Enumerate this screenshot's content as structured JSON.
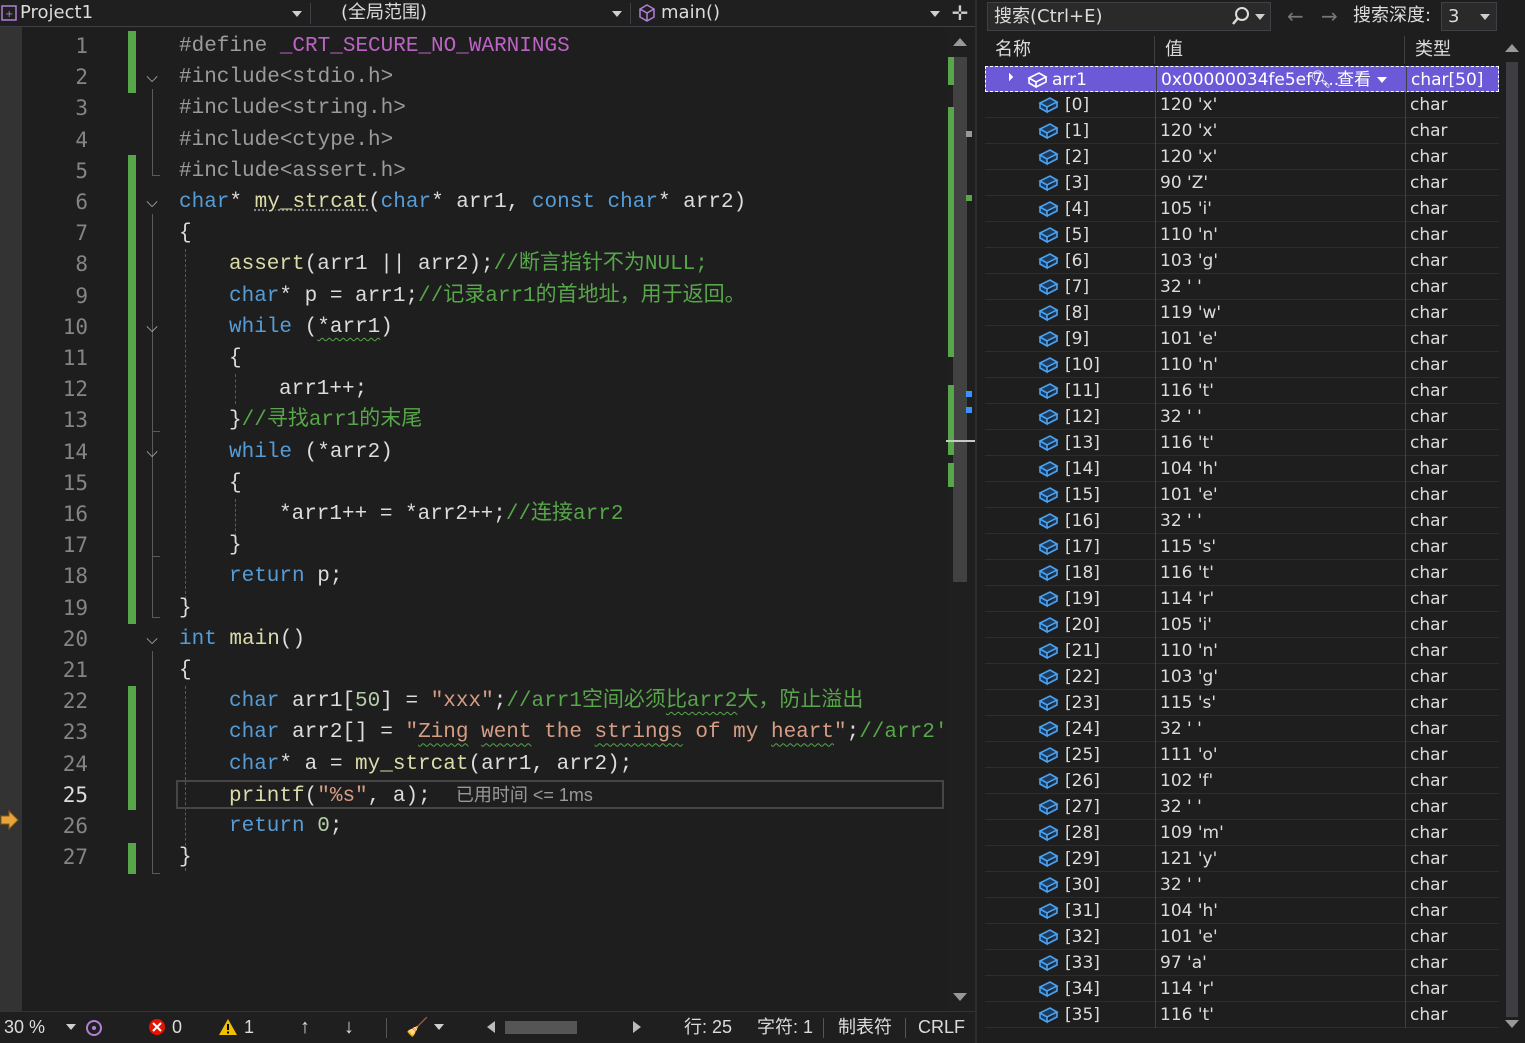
{
  "nav": {
    "project": "Project1",
    "scope": "(全局范围)",
    "function": "main()"
  },
  "editor": {
    "current_line": 25,
    "perf_tip": "已用时间 <= 1ms",
    "lines": [
      {
        "n": "1"
      },
      {
        "n": "2"
      },
      {
        "n": "3"
      },
      {
        "n": "4"
      },
      {
        "n": "5"
      },
      {
        "n": "6"
      },
      {
        "n": "7"
      },
      {
        "n": "8"
      },
      {
        "n": "9"
      },
      {
        "n": "10"
      },
      {
        "n": "11"
      },
      {
        "n": "12"
      },
      {
        "n": "13"
      },
      {
        "n": "14"
      },
      {
        "n": "15"
      },
      {
        "n": "16"
      },
      {
        "n": "17"
      },
      {
        "n": "18"
      },
      {
        "n": "19"
      },
      {
        "n": "20"
      },
      {
        "n": "21"
      },
      {
        "n": "22"
      },
      {
        "n": "23"
      },
      {
        "n": "24"
      },
      {
        "n": "25"
      },
      {
        "n": "26"
      },
      {
        "n": "27"
      }
    ],
    "code": {
      "l1": {
        "a": "#define ",
        "b": "_CRT_SECURE_NO_WARNINGS"
      },
      "l2": "#include<stdio.h>",
      "l3": "#include<string.h>",
      "l4": "#include<ctype.h>",
      "l5": "#include<assert.h>",
      "l6": {
        "t1": "char",
        "t2": "* ",
        "fn": "my_strcat",
        "t3": "(",
        "t4": "char",
        "t5": "* arr1, ",
        "t6": "const",
        "t7": " ",
        "t8": "char",
        "t9": "* arr2)"
      },
      "l7": "{",
      "l8": {
        "fn": "assert",
        "t1": "(arr1 || arr2);",
        "cm": "//断言指针不为NULL;"
      },
      "l9": {
        "kw": "char",
        "t1": "* p = arr1;",
        "cm": "//记录arr1的首地址，用于返回。"
      },
      "l10": {
        "kw": "while",
        "t1": " (",
        "w": "*arr1",
        "t2": ")"
      },
      "l11": "{",
      "l12": "arr1++;",
      "l13": {
        "t1": "}",
        "cm": "//寻找arr1的末尾"
      },
      "l14": {
        "kw": "while",
        "t1": " (*arr2)"
      },
      "l15": "{",
      "l16": {
        "t1": "*arr1++ = *arr2++;",
        "cm": "//连接arr2"
      },
      "l17": "}",
      "l18": {
        "kw": "return",
        "t1": " p;"
      },
      "l19": "}",
      "l20": {
        "kw": "int",
        "t1": " ",
        "fn": "main",
        "t2": "()"
      },
      "l21": "{",
      "l22": {
        "kw": "char",
        "t1": " arr1[",
        "num": "50",
        "t2": "] = ",
        "st": "\"xxx\"",
        "t3": ";",
        "cm1": "//arr1空间必须",
        "cmw": "比arr2",
        "cm2": "大，防止溢出"
      },
      "l23": {
        "kw": "char",
        "t1": " arr2[] = ",
        "s1": "\"",
        "w1": "Zing",
        "s2": " ",
        "w2": "went",
        "s3": " the ",
        "w3": "strings",
        "s4": " of my ",
        "w4": "heart",
        "s5": "\"",
        "t2": ";",
        "cm": "//arr2'"
      },
      "l24": {
        "kw": "char",
        "t1": "* a = ",
        "fn": "my_strcat",
        "t2": "(arr1, arr2);"
      },
      "l25": {
        "fn": "printf",
        "t1": "(",
        "st": "\"%s\"",
        "t2": ", a);"
      },
      "l26": {
        "kw": "return",
        "t1": " ",
        "num": "0",
        "t2": ";"
      },
      "l27": "}"
    }
  },
  "statusbar": {
    "zoom": "30 %",
    "errors": "0",
    "warnings": "1",
    "line": "行: 25",
    "char": "字符: 1",
    "tabs": "制表符",
    "eol": "CRLF"
  },
  "watch": {
    "search_placeholder": "搜索(Ctrl+E)",
    "depth_label": "搜索深度:",
    "depth_value": "3",
    "columns": {
      "name": "名称",
      "value": "值",
      "type": "类型"
    },
    "root": {
      "name": "arr1",
      "value": "0x00000034fe5ef7...",
      "view": "查看",
      "type": "char[50]"
    },
    "items": [
      {
        "name": "[0]",
        "value": "120 'x'",
        "type": "char"
      },
      {
        "name": "[1]",
        "value": "120 'x'",
        "type": "char"
      },
      {
        "name": "[2]",
        "value": "120 'x'",
        "type": "char"
      },
      {
        "name": "[3]",
        "value": "90 'Z'",
        "type": "char"
      },
      {
        "name": "[4]",
        "value": "105 'i'",
        "type": "char"
      },
      {
        "name": "[5]",
        "value": "110 'n'",
        "type": "char"
      },
      {
        "name": "[6]",
        "value": "103 'g'",
        "type": "char"
      },
      {
        "name": "[7]",
        "value": "32 ' '",
        "type": "char"
      },
      {
        "name": "[8]",
        "value": "119 'w'",
        "type": "char"
      },
      {
        "name": "[9]",
        "value": "101 'e'",
        "type": "char"
      },
      {
        "name": "[10]",
        "value": "110 'n'",
        "type": "char"
      },
      {
        "name": "[11]",
        "value": "116 't'",
        "type": "char"
      },
      {
        "name": "[12]",
        "value": "32 ' '",
        "type": "char"
      },
      {
        "name": "[13]",
        "value": "116 't'",
        "type": "char"
      },
      {
        "name": "[14]",
        "value": "104 'h'",
        "type": "char"
      },
      {
        "name": "[15]",
        "value": "101 'e'",
        "type": "char"
      },
      {
        "name": "[16]",
        "value": "32 ' '",
        "type": "char"
      },
      {
        "name": "[17]",
        "value": "115 's'",
        "type": "char"
      },
      {
        "name": "[18]",
        "value": "116 't'",
        "type": "char"
      },
      {
        "name": "[19]",
        "value": "114 'r'",
        "type": "char"
      },
      {
        "name": "[20]",
        "value": "105 'i'",
        "type": "char"
      },
      {
        "name": "[21]",
        "value": "110 'n'",
        "type": "char"
      },
      {
        "name": "[22]",
        "value": "103 'g'",
        "type": "char"
      },
      {
        "name": "[23]",
        "value": "115 's'",
        "type": "char"
      },
      {
        "name": "[24]",
        "value": "32 ' '",
        "type": "char"
      },
      {
        "name": "[25]",
        "value": "111 'o'",
        "type": "char"
      },
      {
        "name": "[26]",
        "value": "102 'f'",
        "type": "char"
      },
      {
        "name": "[27]",
        "value": "32 ' '",
        "type": "char"
      },
      {
        "name": "[28]",
        "value": "109 'm'",
        "type": "char"
      },
      {
        "name": "[29]",
        "value": "121 'y'",
        "type": "char"
      },
      {
        "name": "[30]",
        "value": "32 ' '",
        "type": "char"
      },
      {
        "name": "[31]",
        "value": "104 'h'",
        "type": "char"
      },
      {
        "name": "[32]",
        "value": "101 'e'",
        "type": "char"
      },
      {
        "name": "[33]",
        "value": "97 'a'",
        "type": "char"
      },
      {
        "name": "[34]",
        "value": "114 'r'",
        "type": "char"
      },
      {
        "name": "[35]",
        "value": "116 't'",
        "type": "char"
      }
    ]
  },
  "colors": {
    "accent": "#6b59d8",
    "change_bar": "#57a64a",
    "keyword": "#569cd6",
    "function": "#dcdcaa",
    "comment": "#57a64a",
    "string": "#d69d85"
  }
}
